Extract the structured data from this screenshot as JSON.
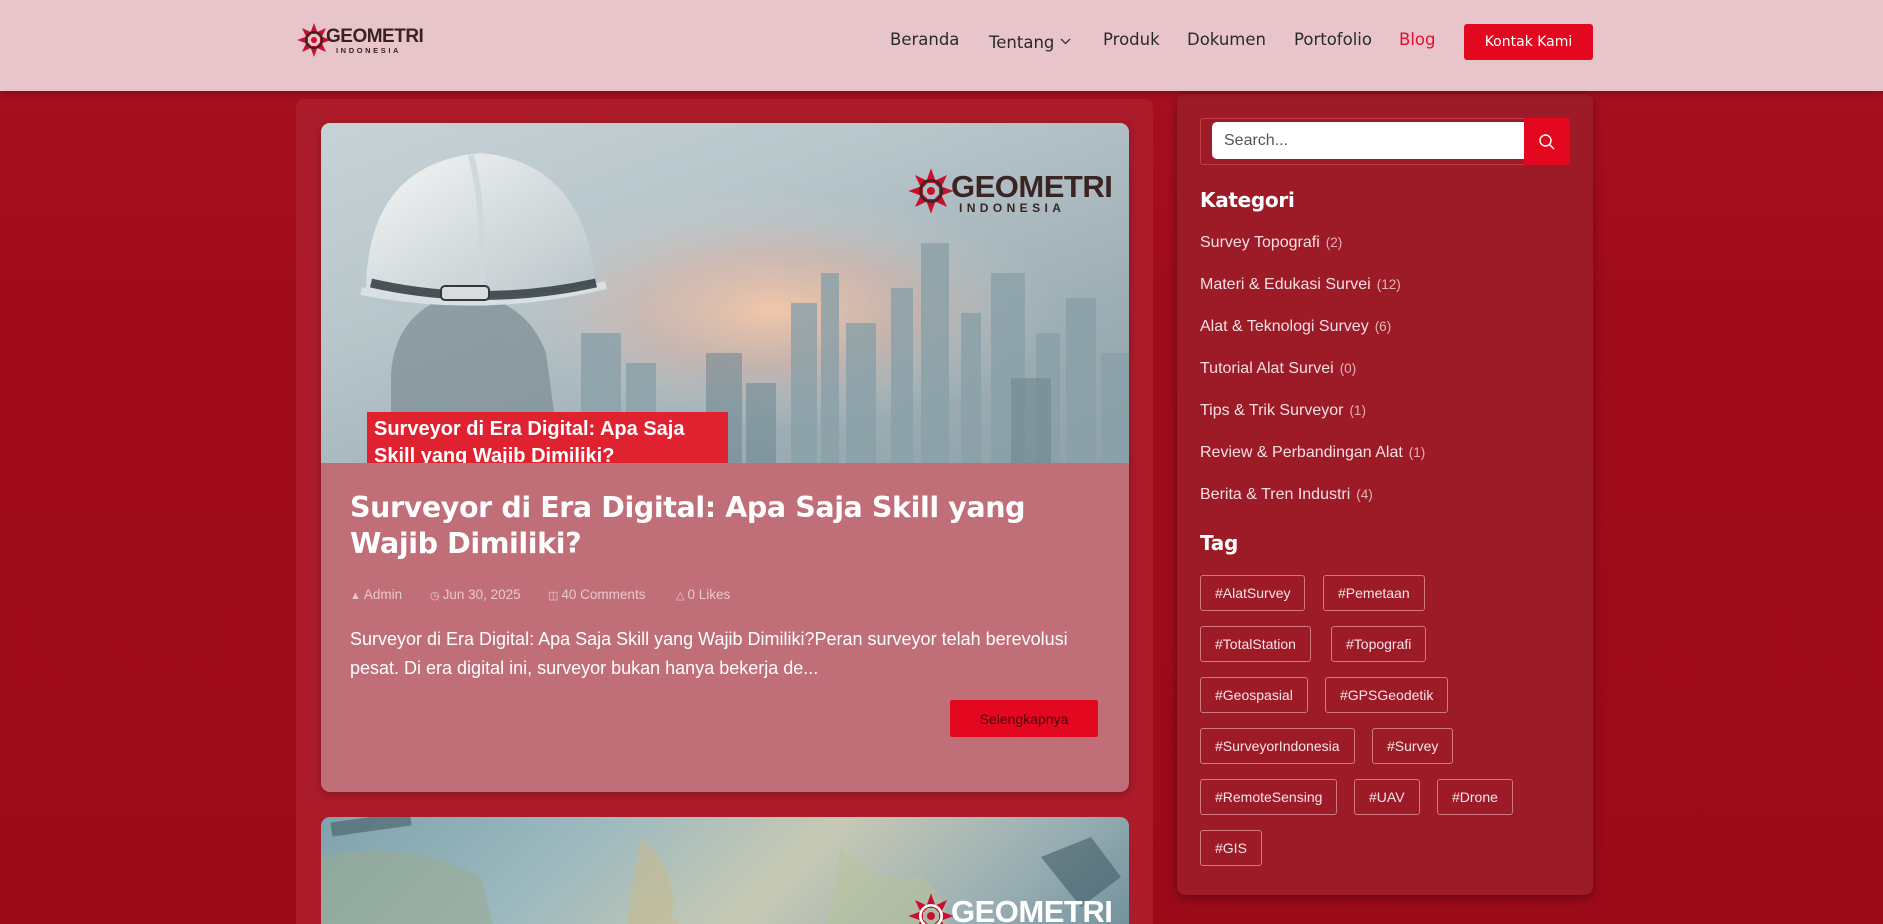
{
  "header": {
    "logo_main": "GEOMETRI",
    "logo_sub": "INDONESIA",
    "nav": [
      {
        "label": "Beranda"
      },
      {
        "label": "Tentang"
      },
      {
        "label": "Produk"
      },
      {
        "label": "Dokumen"
      },
      {
        "label": "Portofolio"
      },
      {
        "label": "Blog"
      }
    ],
    "contact_button": "Kontak Kami"
  },
  "post": {
    "image_logo_main": "GEOMETRI",
    "image_logo_sub": "INDONESIA",
    "image_caption": "Surveyor di Era Digital: Apa Saja Skill yang Wajib Dimiliki?",
    "title": "Surveyor di Era Digital: Apa Saja Skill yang Wajib Dimiliki?",
    "meta": {
      "author": "Admin",
      "date": "Jun 30, 2025",
      "comments": "40 Comments",
      "likes": "0 Likes"
    },
    "excerpt": "Surveyor di Era Digital: Apa Saja Skill yang Wajib Dimiliki?Peran surveyor telah berevolusi pesat. Di era digital ini, surveyor bukan hanya bekerja de...",
    "read_more": "Selengkapnya"
  },
  "post2": {
    "image_logo_main": "GEOMETRI"
  },
  "sidebar": {
    "search_placeholder": "Search...",
    "categories_heading": "Kategori",
    "categories": [
      {
        "label": "Survey Topografi",
        "count": "(2)"
      },
      {
        "label": "Materi & Edukasi Survei",
        "count": "(12)"
      },
      {
        "label": "Alat & Teknologi Survey",
        "count": "(6)"
      },
      {
        "label": "Tutorial Alat Survei",
        "count": "(0)"
      },
      {
        "label": "Tips & Trik Surveyor",
        "count": "(1)"
      },
      {
        "label": "Review & Perbandingan Alat",
        "count": "(1)"
      },
      {
        "label": "Berita & Tren Industri",
        "count": "(4)"
      }
    ],
    "tags_heading": "Tag",
    "tags": [
      "#AlatSurvey",
      "#Pemetaan",
      "#TotalStation",
      "#Topografi",
      "#Geospasial",
      "#GPSGeodetik",
      "#SurveyorIndonesia",
      "#Survey",
      "#RemoteSensing",
      "#UAV",
      "#Drone",
      "#GIS"
    ]
  },
  "colors": {
    "accent": "#e3081f",
    "header_bg": "#e8c5ca",
    "page_bg": "#a00b1a",
    "card_bg": "#c06e77",
    "sidebar_bg": "#9d1a27",
    "active_nav": "#e3102b"
  },
  "icons": {
    "logo": "geometri-star-logo",
    "nav_dropdown": "chevron-down-icon",
    "search": "search-icon",
    "author": "user-icon",
    "date": "clock-icon",
    "comments": "comment-icon",
    "likes": "like-icon"
  }
}
